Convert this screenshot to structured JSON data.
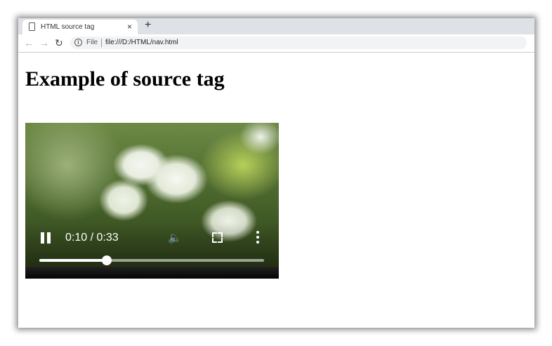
{
  "browser": {
    "tab_title": "HTML source tag",
    "close_glyph": "×",
    "new_tab_glyph": "+",
    "back_glyph": "←",
    "forward_glyph": "→",
    "reload_glyph": "↻",
    "info_glyph": "i",
    "scheme_label": "File",
    "url": "file:///D:/HTML/nav.html"
  },
  "page": {
    "heading": "Example of source tag"
  },
  "video": {
    "time": "0:10 / 0:33",
    "volume_glyph": "🔈",
    "progress": 0.3,
    "state": "playing"
  }
}
